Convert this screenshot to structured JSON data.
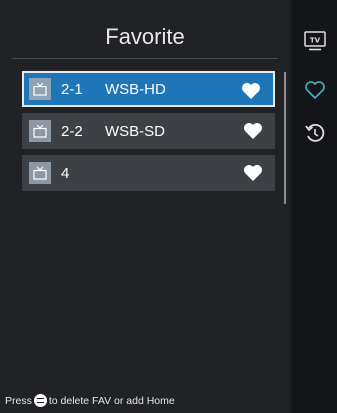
{
  "header": {
    "title": "Favorite"
  },
  "channels": [
    {
      "number": "2-1",
      "name": "WSB-HD",
      "selected": true
    },
    {
      "number": "2-2",
      "name": "WSB-SD",
      "selected": false
    },
    {
      "number": "4",
      "name": "",
      "selected": false
    }
  ],
  "sidebar": {
    "items": [
      {
        "icon": "tv-icon",
        "label": "TV"
      },
      {
        "icon": "heart-outline-icon",
        "active": true
      },
      {
        "icon": "history-icon"
      }
    ]
  },
  "footer": {
    "hint_prefix": "Press",
    "hint_button_icon": "ok-button-icon",
    "hint_suffix": "to delete FAV or add Home"
  },
  "colors": {
    "selected_row": "#1e75b8",
    "row": "#3d4146",
    "accent_teal": "#3fb6c4"
  }
}
